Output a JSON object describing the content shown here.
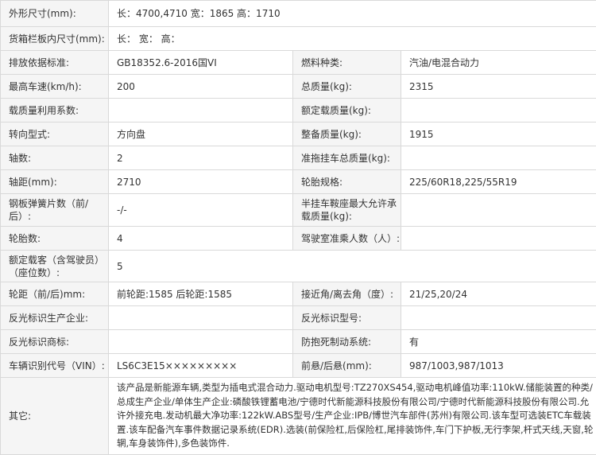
{
  "rows": [
    {
      "l1": "外形尺寸(mm):",
      "v1": "长：4700,4710 宽：1865 高：1710"
    },
    {
      "l1": "货箱栏板内尺寸(mm):",
      "v1": "长： 宽： 高："
    },
    {
      "l1": "排放依据标准:",
      "v1": "GB18352.6-2016国VI",
      "l2": "燃料种类:",
      "v2": "汽油/电混合动力"
    },
    {
      "l1": "最高车速(km/h):",
      "v1": "200",
      "l2": "总质量(kg):",
      "v2": "2315"
    },
    {
      "l1": "载质量利用系数:",
      "v1": "",
      "l2": "额定载质量(kg):",
      "v2": ""
    },
    {
      "l1": "转向型式:",
      "v1": "方向盘",
      "l2": "整备质量(kg):",
      "v2": "1915"
    },
    {
      "l1": "轴数:",
      "v1": "2",
      "l2": "准拖挂车总质量(kg):",
      "v2": ""
    },
    {
      "l1": "轴距(mm):",
      "v1": "2710",
      "l2": "轮胎规格:",
      "v2": "225/60R18,225/55R19"
    },
    {
      "l1": "钢板弹簧片数（前/后）:",
      "v1": "-/-",
      "l2": "半挂车鞍座最大允许承载质量(kg):",
      "v2": ""
    },
    {
      "l1": "轮胎数:",
      "v1": "4",
      "l2": "驾驶室准乘人数（人）:",
      "v2": ""
    },
    {
      "l1": "额定载客（含驾驶员）（座位数）:",
      "v1": "5"
    },
    {
      "l1": "轮距（前/后)mm:",
      "v1": "前轮距:1585 后轮距:1585",
      "l2": "接近角/离去角（度）:",
      "v2": "21/25,20/24"
    },
    {
      "l1": "反光标识生产企业:",
      "v1": "",
      "l2": "反光标识型号:",
      "v2": ""
    },
    {
      "l1": "反光标识商标:",
      "v1": "",
      "l2": "防抱死制动系统:",
      "v2": "有"
    },
    {
      "l1": "车辆识别代号（VIN）:",
      "v1": "LS6C3E15×××××××××",
      "l2": "前悬/后悬(mm):",
      "v2": "987/1003,987/1013"
    }
  ],
  "other": {
    "label": "其它:",
    "text": "该产品是新能源车辆,类型为插电式混合动力.驱动电机型号:TZ270XS454,驱动电机峰值功率:110kW.储能装置的种类/总成生产企业/单体生产企业:磷酸铁锂蓄电池/宁德时代新能源科技股份有限公司/宁德时代新能源科技股份有限公司.允许外接充电.发动机最大净功率:122kW.ABS型号/生产企业:IPB/博世汽车部件(苏州)有限公司.该车型可选装ETC车载装置.该车配备汽车事件数据记录系统(EDR).选装(前保险杠,后保险杠,尾排装饰件,车门下护板,无行李架,杆式天线,天窗,轮辋,车身装饰件),多色装饰件."
  }
}
